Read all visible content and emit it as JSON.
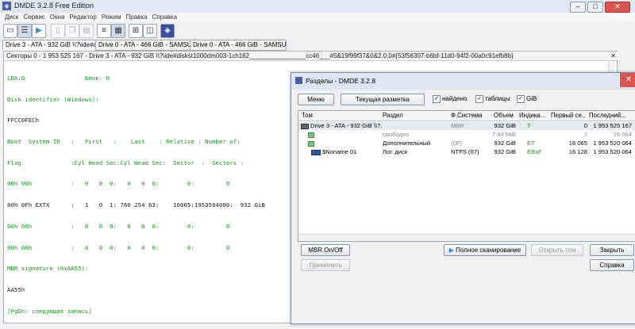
{
  "app": {
    "title": "DMDE 3.2.8 Free Edition",
    "logo": "◈"
  },
  "window_buttons": {
    "minimize": "–",
    "maximize": "□",
    "close": "✕"
  },
  "menu": [
    "Диск",
    "Сервис",
    "Окна",
    "Редактор",
    "Режим",
    "Правка",
    "Справка"
  ],
  "toolbar_icons": [
    "disk-icon",
    "partitions-icon",
    "play-icon",
    "file-icon",
    "copy-icon",
    "paste-icon",
    "list-icon",
    "hex-icon",
    "table-icon",
    "panels-icon",
    "windows-icon",
    "dmde-icon"
  ],
  "drive_tabs": [
    "Drive 3 - ATA - 932 GiB \\\\?\\ide#d...",
    "Drive 0 - ATA - 466 GiB - SAMSUNG...",
    "Drive 0 - ATA - 466 GiB - SAMSUNG..."
  ],
  "sector_panel": {
    "title": "Секторы 0 - 1 953 525 167 - Drive 3 - ATA - 932 GiB \\\\?\\ide#diskst1000dm003-1ch162________________cc46___#5&19f99f37&0&2.0.0#{53f56307-b6bf-11d0-94f2-00a0c91efb8b}",
    "close": "✕",
    "lines": [
      {
        "t": "LBA:0                 Блок: 0",
        "c": "g"
      },
      {
        "t": "Disk identifier (Windows):",
        "c": "g"
      },
      {
        "t": "FFCC0FECh",
        "c": "w"
      },
      {
        "t": "Boot  System ID   :   First   :    Last    : Relative : Number of:",
        "c": "g"
      },
      {
        "t": "Flag              :Cyl Head Sec:Cyl Head Sec:  Sector  :  Sectors :",
        "c": "g"
      },
      {
        "t": "00h 00h           :   0   0  0:   0   0  0:        0:         0",
        "c": "g"
      },
      {
        "t": "00h 0Fh EXTX      :   1   0  1: 760 254 63:    16065:1953504000:  932 GiB",
        "c": "w"
      },
      {
        "t": "00h 00h           :   0   0  0:   0   0  0:        0:         0",
        "c": "g"
      },
      {
        "t": "00h 00h           :   0   0  0:   0   0  0:        0:         0",
        "c": "g"
      },
      {
        "t": "MBR signature (0xAA55):",
        "c": "g"
      },
      {
        "t": "AA55h",
        "c": "w"
      },
      {
        "t": "[PgDn: следующая запись]",
        "c": "g"
      }
    ]
  },
  "dialog": {
    "title": "Разделы - DMDE 3.2.8",
    "close": "✕",
    "menu_button": "Меню",
    "layout_button": "Текущая разметка",
    "checkboxes": [
      {
        "label": "найдено",
        "checked": true
      },
      {
        "label": "таблицы",
        "checked": true
      },
      {
        "label": "GiB",
        "checked": true
      }
    ],
    "check_mark": "✓",
    "columns": [
      "Том",
      "Раздел",
      "Ф.Система",
      "Объем",
      "Индика...",
      "Первый се...",
      "Последний..."
    ],
    "rows": [
      {
        "vol": "Drive 3 - ATA - 932 GiB \\\\?...",
        "part": "",
        "fs": "MBR",
        "size": "932 GiB",
        "ind": "T",
        "first": "0",
        "last": "1 953 525 167",
        "style": "disk"
      },
      {
        "vol": "",
        "part": "свободно",
        "fs": "",
        "size": "7.84 MiB",
        "ind": "",
        "first": "1",
        "last": "16 064",
        "style": "free"
      },
      {
        "vol": "",
        "part": "Дополнительный",
        "fs": "(0F)",
        "size": "932 GiB",
        "ind": "ET",
        "first": "16 065",
        "last": "1 953 520 064",
        "style": "ext"
      },
      {
        "vol": "$Noname 01",
        "part": "Лог. диск",
        "fs": "NTFS (07)",
        "size": "932 GiB",
        "ind": "EBxF",
        "first": "16 128",
        "last": "1 953 520 064",
        "style": "logical"
      }
    ],
    "buttons": {
      "mbr": "MBR On/Off",
      "apply": "Применить",
      "full_scan": "Полное сканирование",
      "open_volume": "Открыть том",
      "close": "Закрыть",
      "help": "Справка"
    }
  }
}
